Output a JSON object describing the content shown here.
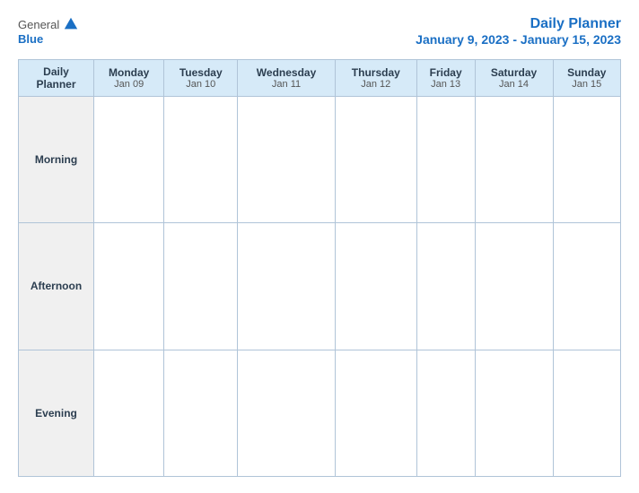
{
  "header": {
    "logo_general": "General",
    "logo_blue": "Blue",
    "title": "Daily Planner",
    "date_range": "January 9, 2023 - January 15, 2023"
  },
  "columns": [
    {
      "id": "daily-planner",
      "day": "Daily",
      "sub": "Planner"
    },
    {
      "id": "monday",
      "day": "Monday",
      "sub": "Jan 09"
    },
    {
      "id": "tuesday",
      "day": "Tuesday",
      "sub": "Jan 10"
    },
    {
      "id": "wednesday",
      "day": "Wednesday",
      "sub": "Jan 11"
    },
    {
      "id": "thursday",
      "day": "Thursday",
      "sub": "Jan 12"
    },
    {
      "id": "friday",
      "day": "Friday",
      "sub": "Jan 13"
    },
    {
      "id": "saturday",
      "day": "Saturday",
      "sub": "Jan 14"
    },
    {
      "id": "sunday",
      "day": "Sunday",
      "sub": "Jan 15"
    }
  ],
  "rows": [
    {
      "id": "morning",
      "label": "Morning"
    },
    {
      "id": "afternoon",
      "label": "Afternoon"
    },
    {
      "id": "evening",
      "label": "Evening"
    }
  ]
}
